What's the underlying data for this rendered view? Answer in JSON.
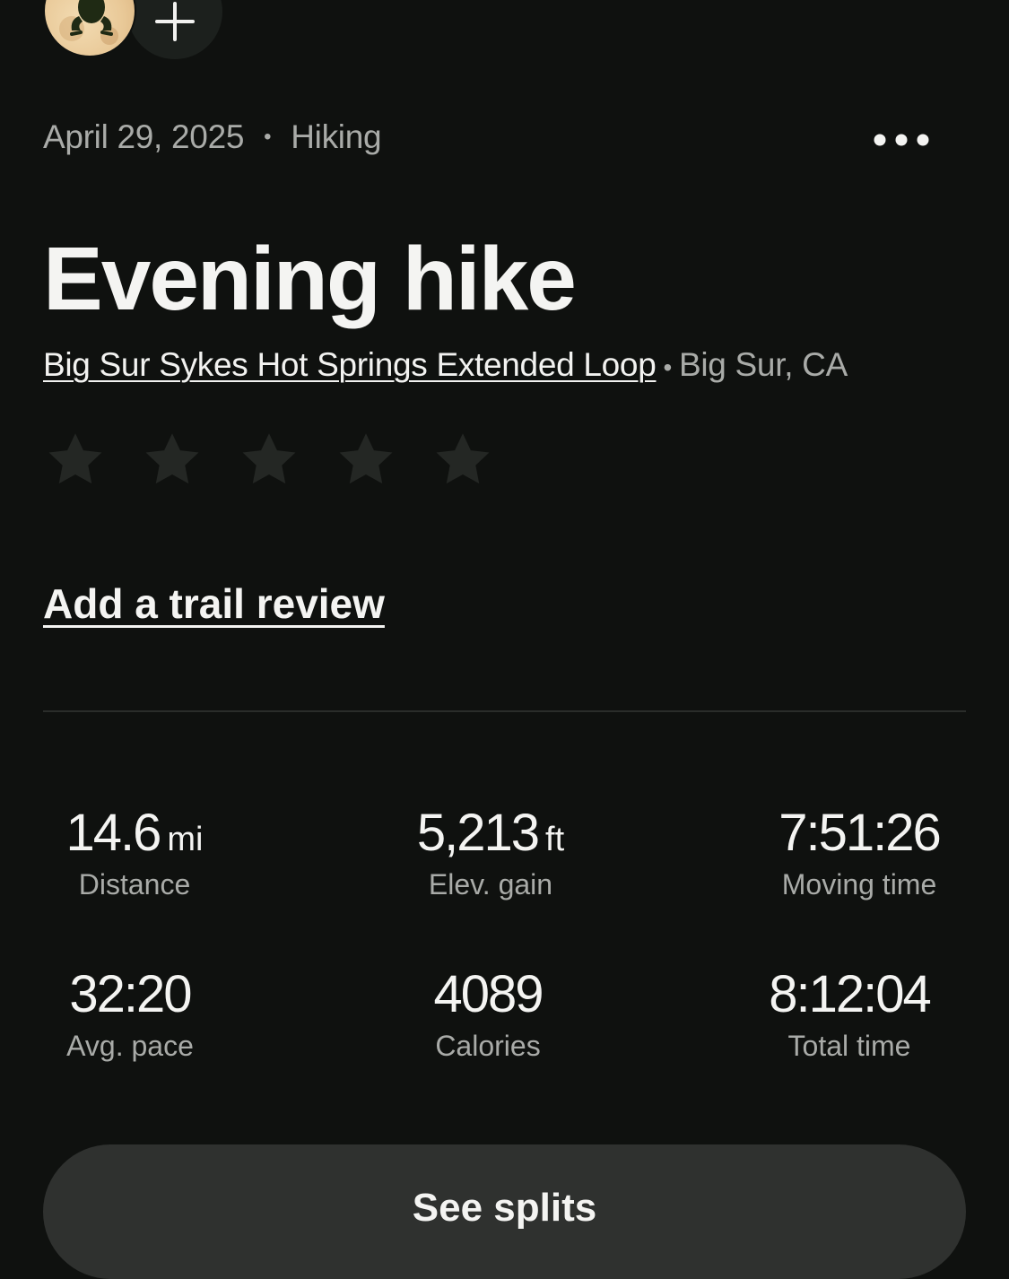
{
  "header": {
    "avatar_icon": "frog-avatar-icon",
    "add_icon": "plus-icon"
  },
  "activity": {
    "date": "April 29, 2025",
    "separator": "•",
    "type": "Hiking",
    "more_icon": "more-horizontal-icon",
    "title": "Evening hike",
    "trail_name": "Big Sur Sykes Hot Springs Extended Loop",
    "location_separator": "•",
    "location": "Big Sur, CA"
  },
  "rating": {
    "max_stars": 5,
    "value": 0,
    "star_color": "#242724"
  },
  "review": {
    "link_label": "Add a trail review"
  },
  "stats": [
    {
      "value": "14.6",
      "unit": "mi",
      "label": "Distance"
    },
    {
      "value": "5,213",
      "unit": "ft",
      "label": "Elev. gain"
    },
    {
      "value": "7:51:26",
      "unit": "",
      "label": "Moving time"
    },
    {
      "value": "32:20",
      "unit": "",
      "label": "Avg. pace"
    },
    {
      "value": "4089",
      "unit": "",
      "label": "Calories"
    },
    {
      "value": "8:12:04",
      "unit": "",
      "label": "Total time"
    }
  ],
  "actions": {
    "see_splits_label": "See splits"
  },
  "colors": {
    "background": "#0f110f",
    "text_primary": "#f4f4f2",
    "text_secondary": "#a9aba8",
    "button_bg": "#2f312f"
  }
}
